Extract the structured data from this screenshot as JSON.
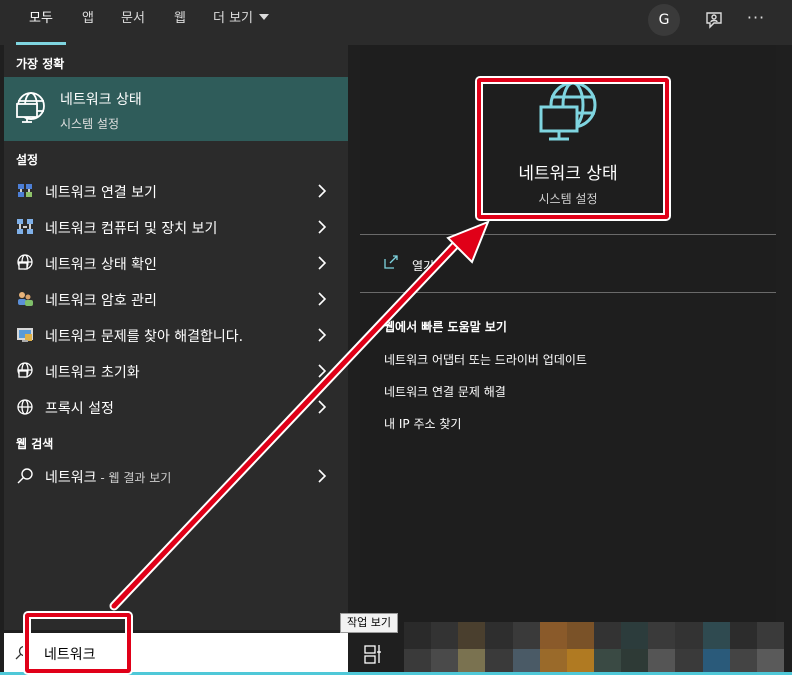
{
  "tabs": [
    {
      "label": "모두",
      "active": true
    },
    {
      "label": "앱"
    },
    {
      "label": "문서"
    },
    {
      "label": "웹"
    },
    {
      "label": "더 보기"
    }
  ],
  "header": {
    "avatar": "G",
    "more": "···"
  },
  "best_match": {
    "section": "가장 정확",
    "title": "네트워크 상태",
    "subtitle": "시스템 설정",
    "icon": "globe-monitor-icon"
  },
  "settings": {
    "section": "설정",
    "items": [
      {
        "label": "네트워크 연결 보기",
        "icon": "network-connections-icon"
      },
      {
        "label": "네트워크 컴퓨터 및 장치 보기",
        "icon": "network-computers-icon"
      },
      {
        "label": "네트워크 상태 확인",
        "icon": "globe-icon"
      },
      {
        "label": "네트워크 암호 관리",
        "icon": "users-key-icon"
      },
      {
        "label": "네트워크 문제를 찾아 해결합니다.",
        "icon": "troubleshoot-icon"
      },
      {
        "label": "네트워크 초기화",
        "icon": "globe-reset-icon"
      },
      {
        "label": "프록시 설정",
        "icon": "globe-proxy-icon"
      }
    ]
  },
  "web": {
    "section": "웹 검색",
    "query": "네트워크",
    "suffix": " - 웹 결과 보기"
  },
  "preview": {
    "title": "네트워크 상태",
    "subtitle": "시스템 설정",
    "open": "열기",
    "help_heading": "웹에서 빠른 도움말 보기",
    "help_links": [
      "네트워크 어댑터 또는 드라이버 업데이트",
      "네트워크 연결 문제 해결",
      "내 IP 주소 찾기"
    ]
  },
  "search": {
    "value": "네트워크"
  },
  "taskbar": {
    "tooltip": "작업 보기"
  },
  "colors": {
    "accent": "#7fd5e0",
    "selected": "#2f5c5a",
    "annotation": "#e00018"
  }
}
